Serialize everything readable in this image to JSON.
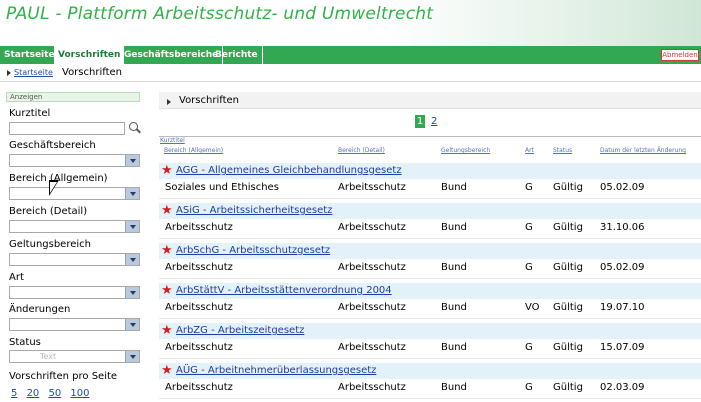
{
  "app": {
    "title": "PAUL - Plattform Arbeitsschutz- und Umweltrecht"
  },
  "nav": {
    "tabs": [
      "Startseite",
      "Vorschriften",
      "Geschäftsbereiche",
      "Berichte"
    ],
    "active": "Vorschriften",
    "right_label": "Abmelden"
  },
  "breadcrumb": {
    "home": "Startseite",
    "current": "Vorschriften"
  },
  "sidebar": {
    "header": "Anzeigen",
    "kurztitel_label": "Kurztitel",
    "kurztitel_value": "",
    "filters": [
      {
        "label": "Geschäftsbereich",
        "value": ""
      },
      {
        "label": "Bereich (Allgemein)",
        "value": ""
      },
      {
        "label": "Bereich (Detail)",
        "value": ""
      },
      {
        "label": "Geltungsbereich",
        "value": ""
      },
      {
        "label": "Art",
        "value": ""
      },
      {
        "label": "Änderungen",
        "value": ""
      },
      {
        "label": "Status",
        "value": "Text"
      }
    ],
    "per_page_label": "Vorschriften pro Seite",
    "per_page_options": [
      "5",
      "20",
      "50",
      "100"
    ]
  },
  "main": {
    "panel_title": "Vorschriften",
    "pager": {
      "current": "1",
      "pages": [
        "2"
      ]
    },
    "table": {
      "kurztitel_header": "Kurztitel",
      "headers": [
        "Bereich (Allgemein)",
        "Bereich (Detail)",
        "Geltungsbereich",
        "Art",
        "Status",
        "Datum der letzten Änderung"
      ],
      "rows": [
        {
          "title": "AGG - Allgemeines Gleichbehandlungsgesetz",
          "allgemein": "Soziales und Ethisches",
          "detail": "Arbeitsschutz",
          "geltung": "Bund",
          "art": "G",
          "status": "Gültig",
          "datum": "05.02.09"
        },
        {
          "title": "ASiG - Arbeitssicherheitsgesetz",
          "allgemein": "Arbeitsschutz",
          "detail": "Arbeitsschutz",
          "geltung": "Bund",
          "art": "G",
          "status": "Gültig",
          "datum": "31.10.06"
        },
        {
          "title": "ArbSchG - Arbeitsschutzgesetz",
          "allgemein": "Arbeitsschutz",
          "detail": "Arbeitsschutz",
          "geltung": "Bund",
          "art": "G",
          "status": "Gültig",
          "datum": "05.02.09"
        },
        {
          "title": "ArbStättV - Arbeitsstättenverordnung 2004",
          "allgemein": "Arbeitsschutz",
          "detail": "Arbeitsschutz",
          "geltung": "Bund",
          "art": "VO",
          "status": "Gültig",
          "datum": "19.07.10"
        },
        {
          "title": "ArbZG - Arbeitszeitgesetz",
          "allgemein": "Arbeitsschutz",
          "detail": "Arbeitsschutz",
          "geltung": "Bund",
          "art": "G",
          "status": "Gültig",
          "datum": "15.07.09"
        },
        {
          "title": "AÜG - Arbeitnehmerüberlassungsgesetz",
          "allgemein": "Arbeitsschutz",
          "detail": "Arbeitsschutz",
          "geltung": "Bund",
          "art": "G",
          "status": "Gültig",
          "datum": "02.03.09"
        }
      ]
    }
  },
  "colors": {
    "brand_green": "#33a853",
    "title_green": "#2fb34a",
    "link_blue": "#1a3fa0",
    "row_highlight": "#e3f1f8",
    "star_red": "#d82020"
  },
  "icons": {
    "search": "search-icon",
    "star": "star-icon",
    "dropdown": "chevron-down-icon"
  }
}
